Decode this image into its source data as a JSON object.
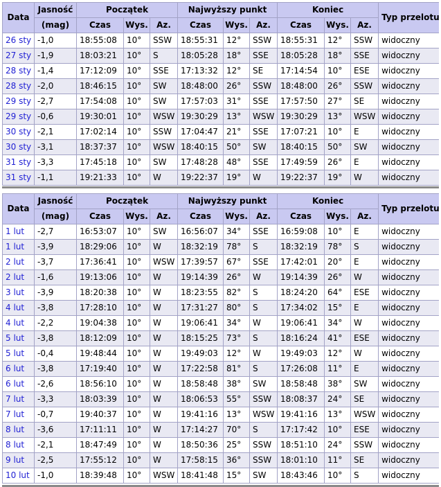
{
  "headers": {
    "data": "Data",
    "jasnosc": "Jasność",
    "mag": "(mag)",
    "poczatek": "Początek",
    "najwyzszy": "Najwyższy punkt",
    "koniec": "Koniec",
    "typ": "Typ przelotu",
    "czas": "Czas",
    "wys": "Wys.",
    "az": "Az."
  },
  "table1": [
    {
      "date": "26 sty",
      "mag": "-1,0",
      "s_time": "18:55:08",
      "s_alt": "10°",
      "s_az": "SSW",
      "h_time": "18:55:31",
      "h_alt": "12°",
      "h_az": "SSW",
      "e_time": "18:55:31",
      "e_alt": "12°",
      "e_az": "SSW",
      "type": "widoczny"
    },
    {
      "date": "27 sty",
      "mag": "-1,9",
      "s_time": "18:03:21",
      "s_alt": "10°",
      "s_az": "S",
      "h_time": "18:05:28",
      "h_alt": "18°",
      "h_az": "SSE",
      "e_time": "18:05:28",
      "e_alt": "18°",
      "e_az": "SSE",
      "type": "widoczny"
    },
    {
      "date": "28 sty",
      "mag": "-1,4",
      "s_time": "17:12:09",
      "s_alt": "10°",
      "s_az": "SSE",
      "h_time": "17:13:32",
      "h_alt": "12°",
      "h_az": "SE",
      "e_time": "17:14:54",
      "e_alt": "10°",
      "e_az": "ESE",
      "type": "widoczny"
    },
    {
      "date": "28 sty",
      "mag": "-2,0",
      "s_time": "18:46:15",
      "s_alt": "10°",
      "s_az": "SW",
      "h_time": "18:48:00",
      "h_alt": "26°",
      "h_az": "SSW",
      "e_time": "18:48:00",
      "e_alt": "26°",
      "e_az": "SSW",
      "type": "widoczny"
    },
    {
      "date": "29 sty",
      "mag": "-2,7",
      "s_time": "17:54:08",
      "s_alt": "10°",
      "s_az": "SW",
      "h_time": "17:57:03",
      "h_alt": "31°",
      "h_az": "SSE",
      "e_time": "17:57:50",
      "e_alt": "27°",
      "e_az": "SE",
      "type": "widoczny"
    },
    {
      "date": "29 sty",
      "mag": "-0,6",
      "s_time": "19:30:01",
      "s_alt": "10°",
      "s_az": "WSW",
      "h_time": "19:30:29",
      "h_alt": "13°",
      "h_az": "WSW",
      "e_time": "19:30:29",
      "e_alt": "13°",
      "e_az": "WSW",
      "type": "widoczny"
    },
    {
      "date": "30 sty",
      "mag": "-2,1",
      "s_time": "17:02:14",
      "s_alt": "10°",
      "s_az": "SSW",
      "h_time": "17:04:47",
      "h_alt": "21°",
      "h_az": "SSE",
      "e_time": "17:07:21",
      "e_alt": "10°",
      "e_az": "E",
      "type": "widoczny"
    },
    {
      "date": "30 sty",
      "mag": "-3,1",
      "s_time": "18:37:37",
      "s_alt": "10°",
      "s_az": "WSW",
      "h_time": "18:40:15",
      "h_alt": "50°",
      "h_az": "SW",
      "e_time": "18:40:15",
      "e_alt": "50°",
      "e_az": "SW",
      "type": "widoczny"
    },
    {
      "date": "31 sty",
      "mag": "-3,3",
      "s_time": "17:45:18",
      "s_alt": "10°",
      "s_az": "SW",
      "h_time": "17:48:28",
      "h_alt": "48°",
      "h_az": "SSE",
      "e_time": "17:49:59",
      "e_alt": "26°",
      "e_az": "E",
      "type": "widoczny"
    },
    {
      "date": "31 sty",
      "mag": "-1,1",
      "s_time": "19:21:33",
      "s_alt": "10°",
      "s_az": "W",
      "h_time": "19:22:37",
      "h_alt": "19°",
      "h_az": "W",
      "e_time": "19:22:37",
      "e_alt": "19°",
      "e_az": "W",
      "type": "widoczny"
    }
  ],
  "table2": [
    {
      "date": "1 lut",
      "mag": "-2,7",
      "s_time": "16:53:07",
      "s_alt": "10°",
      "s_az": "SW",
      "h_time": "16:56:07",
      "h_alt": "34°",
      "h_az": "SSE",
      "e_time": "16:59:08",
      "e_alt": "10°",
      "e_az": "E",
      "type": "widoczny"
    },
    {
      "date": "1 lut",
      "mag": "-3,9",
      "s_time": "18:29:06",
      "s_alt": "10°",
      "s_az": "W",
      "h_time": "18:32:19",
      "h_alt": "78°",
      "h_az": "S",
      "e_time": "18:32:19",
      "e_alt": "78°",
      "e_az": "S",
      "type": "widoczny"
    },
    {
      "date": "2 lut",
      "mag": "-3,7",
      "s_time": "17:36:41",
      "s_alt": "10°",
      "s_az": "WSW",
      "h_time": "17:39:57",
      "h_alt": "67°",
      "h_az": "SSE",
      "e_time": "17:42:01",
      "e_alt": "20°",
      "e_az": "E",
      "type": "widoczny"
    },
    {
      "date": "2 lut",
      "mag": "-1,6",
      "s_time": "19:13:06",
      "s_alt": "10°",
      "s_az": "W",
      "h_time": "19:14:39",
      "h_alt": "26°",
      "h_az": "W",
      "e_time": "19:14:39",
      "e_alt": "26°",
      "e_az": "W",
      "type": "widoczny"
    },
    {
      "date": "3 lut",
      "mag": "-3,9",
      "s_time": "18:20:38",
      "s_alt": "10°",
      "s_az": "W",
      "h_time": "18:23:55",
      "h_alt": "82°",
      "h_az": "S",
      "e_time": "18:24:20",
      "e_alt": "64°",
      "e_az": "ESE",
      "type": "widoczny"
    },
    {
      "date": "4 lut",
      "mag": "-3,8",
      "s_time": "17:28:10",
      "s_alt": "10°",
      "s_az": "W",
      "h_time": "17:31:27",
      "h_alt": "80°",
      "h_az": "S",
      "e_time": "17:34:02",
      "e_alt": "15°",
      "e_az": "E",
      "type": "widoczny"
    },
    {
      "date": "4 lut",
      "mag": "-2,2",
      "s_time": "19:04:38",
      "s_alt": "10°",
      "s_az": "W",
      "h_time": "19:06:41",
      "h_alt": "34°",
      "h_az": "W",
      "e_time": "19:06:41",
      "e_alt": "34°",
      "e_az": "W",
      "type": "widoczny"
    },
    {
      "date": "5 lut",
      "mag": "-3,8",
      "s_time": "18:12:09",
      "s_alt": "10°",
      "s_az": "W",
      "h_time": "18:15:25",
      "h_alt": "73°",
      "h_az": "S",
      "e_time": "18:16:24",
      "e_alt": "41°",
      "e_az": "ESE",
      "type": "widoczny"
    },
    {
      "date": "5 lut",
      "mag": "-0,4",
      "s_time": "19:48:44",
      "s_alt": "10°",
      "s_az": "W",
      "h_time": "19:49:03",
      "h_alt": "12°",
      "h_az": "W",
      "e_time": "19:49:03",
      "e_alt": "12°",
      "e_az": "W",
      "type": "widoczny"
    },
    {
      "date": "6 lut",
      "mag": "-3,8",
      "s_time": "17:19:40",
      "s_alt": "10°",
      "s_az": "W",
      "h_time": "17:22:58",
      "h_alt": "81°",
      "h_az": "S",
      "e_time": "17:26:08",
      "e_alt": "11°",
      "e_az": "E",
      "type": "widoczny"
    },
    {
      "date": "6 lut",
      "mag": "-2,6",
      "s_time": "18:56:10",
      "s_alt": "10°",
      "s_az": "W",
      "h_time": "18:58:48",
      "h_alt": "38°",
      "h_az": "SW",
      "e_time": "18:58:48",
      "e_alt": "38°",
      "e_az": "SW",
      "type": "widoczny"
    },
    {
      "date": "7 lut",
      "mag": "-3,3",
      "s_time": "18:03:39",
      "s_alt": "10°",
      "s_az": "W",
      "h_time": "18:06:53",
      "h_alt": "55°",
      "h_az": "SSW",
      "e_time": "18:08:37",
      "e_alt": "24°",
      "e_az": "SE",
      "type": "widoczny"
    },
    {
      "date": "7 lut",
      "mag": "-0,7",
      "s_time": "19:40:37",
      "s_alt": "10°",
      "s_az": "W",
      "h_time": "19:41:16",
      "h_alt": "13°",
      "h_az": "WSW",
      "e_time": "19:41:16",
      "e_alt": "13°",
      "e_az": "WSW",
      "type": "widoczny"
    },
    {
      "date": "8 lut",
      "mag": "-3,6",
      "s_time": "17:11:11",
      "s_alt": "10°",
      "s_az": "W",
      "h_time": "17:14:27",
      "h_alt": "70°",
      "h_az": "S",
      "e_time": "17:17:42",
      "e_alt": "10°",
      "e_az": "ESE",
      "type": "widoczny"
    },
    {
      "date": "8 lut",
      "mag": "-2,1",
      "s_time": "18:47:49",
      "s_alt": "10°",
      "s_az": "W",
      "h_time": "18:50:36",
      "h_alt": "25°",
      "h_az": "SSW",
      "e_time": "18:51:10",
      "e_alt": "24°",
      "e_az": "SSW",
      "type": "widoczny"
    },
    {
      "date": "9 lut",
      "mag": "-2,5",
      "s_time": "17:55:12",
      "s_alt": "10°",
      "s_az": "W",
      "h_time": "17:58:15",
      "h_alt": "36°",
      "h_az": "SSW",
      "e_time": "18:01:10",
      "e_alt": "11°",
      "e_az": "SE",
      "type": "widoczny"
    },
    {
      "date": "10 lut",
      "mag": "-1,0",
      "s_time": "18:39:48",
      "s_alt": "10°",
      "s_az": "WSW",
      "h_time": "18:41:48",
      "h_alt": "15°",
      "h_az": "SW",
      "e_time": "18:43:46",
      "e_alt": "10°",
      "e_az": "S",
      "type": "widoczny"
    }
  ]
}
